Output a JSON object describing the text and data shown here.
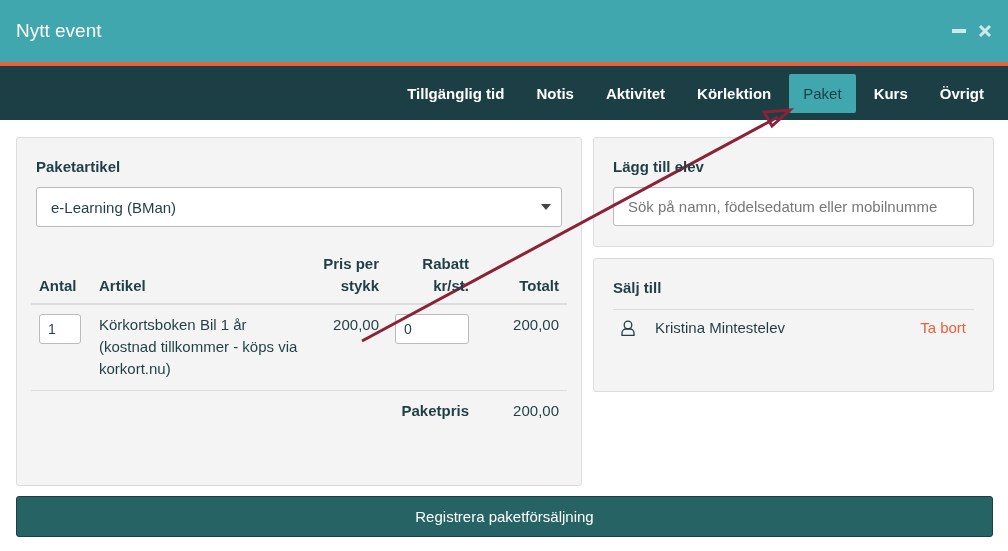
{
  "window": {
    "title": "Nytt event"
  },
  "tabs": [
    {
      "label": "Tillgänglig tid",
      "selected": false
    },
    {
      "label": "Notis",
      "selected": false
    },
    {
      "label": "Aktivitet",
      "selected": false
    },
    {
      "label": "Körlektion",
      "selected": false
    },
    {
      "label": "Paket",
      "selected": true
    },
    {
      "label": "Kurs",
      "selected": false
    },
    {
      "label": "Övrigt",
      "selected": false
    }
  ],
  "package": {
    "label": "Paketartikel",
    "value": "e-Learning (BMan)",
    "columns": [
      "Antal",
      "Artikel",
      "Pris per stykk",
      "Rabatt kr/st.",
      "Totalt"
    ],
    "rows": [
      {
        "quantity": "1",
        "article": "Körkortsboken Bil 1 år (kostnad tillkommer - köps via korkort.nu)",
        "price": "200,00",
        "discount": "0",
        "total": "200,00"
      }
    ],
    "sum_label": "Paketpris",
    "sum": "200,00"
  },
  "add_student": {
    "label": "Lägg till elev",
    "placeholder": "Sök på namn, födelsedatum eller mobilnumme"
  },
  "sell_to": {
    "label": "Sälj till",
    "students": [
      {
        "name": "Kristina Mintestelev",
        "action": "Ta bort"
      }
    ]
  },
  "submit": "Registrera paketförsäljning"
}
